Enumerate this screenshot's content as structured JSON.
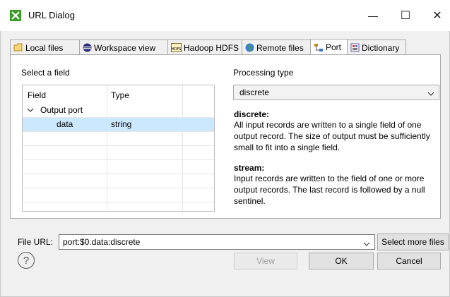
{
  "window": {
    "title": "URL Dialog",
    "minimize_glyph": "—",
    "maximize_glyph": "☐",
    "close_glyph": "✕"
  },
  "tabs": [
    {
      "label": "Local files",
      "icon": "folder-icon",
      "active": false
    },
    {
      "label": "Workspace view",
      "icon": "eclipse-icon",
      "active": false
    },
    {
      "label": "Hadoop HDFS",
      "icon": "hdfs-icon",
      "active": false
    },
    {
      "label": "Remote files",
      "icon": "globe-icon",
      "active": false
    },
    {
      "label": "Port",
      "icon": "port-icon",
      "active": true
    },
    {
      "label": "Dictionary",
      "icon": "dictionary-icon",
      "active": false
    }
  ],
  "field_panel": {
    "label": "Select a field",
    "columns": [
      "Field",
      "Type"
    ],
    "tree_root": "Output port",
    "rows": [
      {
        "field": "data",
        "type": "string",
        "selected": true
      }
    ]
  },
  "processing": {
    "label": "Processing type",
    "selected": "discrete",
    "descriptions": [
      {
        "title": "discrete:",
        "text": "All input records are written to a single field of one output record. The size of output must be sufficiently small to fit into a single field."
      },
      {
        "title": "stream:",
        "text": "Input records are written to the field of one or more output records. The last record is followed by a null sentinel."
      }
    ]
  },
  "file_url": {
    "label": "File URL:",
    "value": "port:$0.data:discrete",
    "select_more_label": "Select more files"
  },
  "footer": {
    "help_glyph": "?",
    "view_label": "View",
    "ok_label": "OK",
    "cancel_label": "Cancel"
  },
  "colors": {
    "selection": "#cce8ff",
    "app_icon": "#3a9d23"
  }
}
